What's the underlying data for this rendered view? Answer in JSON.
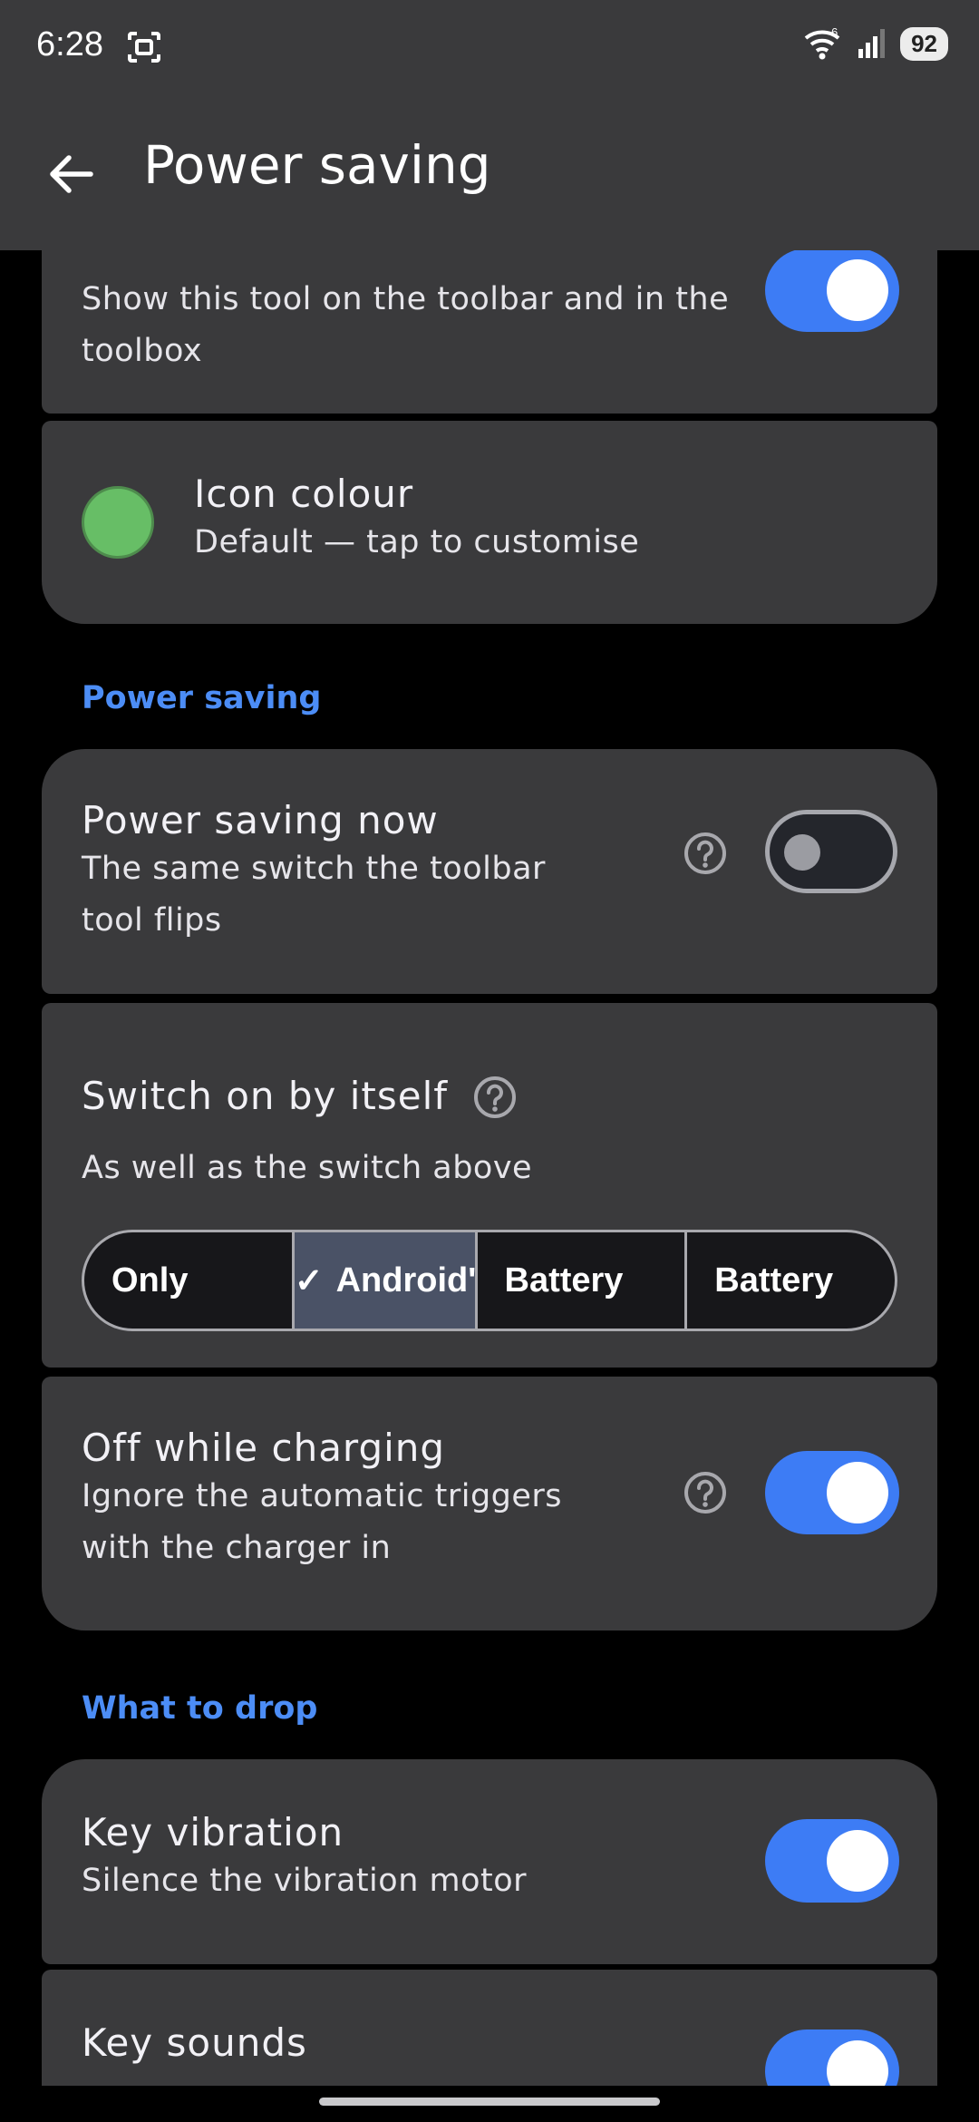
{
  "status_bar": {
    "time": "6:28",
    "battery": "92",
    "wifi_label": "6"
  },
  "app_bar": {
    "title": "Power saving"
  },
  "show_tool": {
    "summary_line1": "Show this tool on the toolbar and in the",
    "summary_line2": "toolbox",
    "enabled": true
  },
  "icon_colour": {
    "title": "Icon colour",
    "summary": "Default — tap to customise",
    "swatch_color": "#67be66"
  },
  "section_power_saving": "Power saving",
  "power_saving_now": {
    "title": "Power saving now",
    "summary_line1": "The same switch the toolbar",
    "summary_line2": "tool flips",
    "enabled": false
  },
  "switch_on": {
    "title": "Switch on by itself",
    "summary": "As well as the switch above",
    "options": [
      "Only",
      "Android'",
      "Battery",
      "Battery"
    ],
    "selected_index": 1,
    "check_glyph": "✓"
  },
  "off_charging": {
    "title": "Off while charging",
    "summary_line1": "Ignore the automatic triggers",
    "summary_line2": "with the charger in",
    "enabled": true
  },
  "section_what_to_drop": "What to drop",
  "key_vibration": {
    "title": "Key vibration",
    "summary": "Silence the vibration motor",
    "enabled": true
  },
  "key_sounds": {
    "title": "Key sounds",
    "enabled": true
  },
  "colors": {
    "accent": "#3d7cf5",
    "card": "#3a3a3c",
    "section_header": "#4c8df6"
  }
}
